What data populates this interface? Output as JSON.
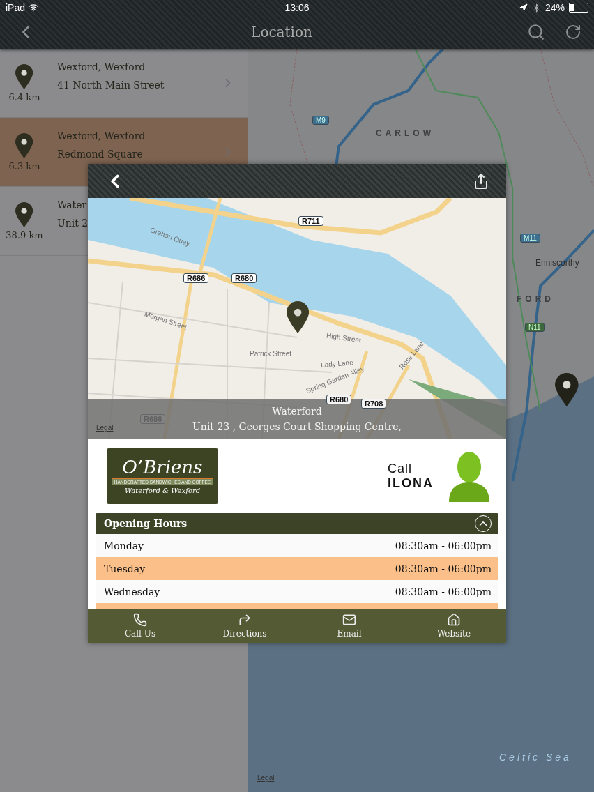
{
  "status_bar": {
    "carrier": "iPad",
    "time": "13:06",
    "battery": "24%"
  },
  "nav": {
    "title": "Location"
  },
  "locations": [
    {
      "distance": "6.4 km",
      "name": "Wexford, Wexford",
      "address": "41 North Main Street",
      "selected": false
    },
    {
      "distance": "6.3 km",
      "name": "Wexford, Wexford",
      "address": "Redmond Square",
      "selected": true
    },
    {
      "distance": "38.9 km",
      "name": "Water",
      "address": "Unit 2",
      "selected": false
    }
  ],
  "map": {
    "labels": [
      "CARLOW",
      "M9",
      "M11",
      "Enniscorthy",
      "FORD",
      "N11",
      "Celtic Sea"
    ],
    "legal": "Legal"
  },
  "detail": {
    "map_labels": [
      "R711",
      "R686",
      "R680",
      "Grattan Quay",
      "Morgan Street",
      "High Street",
      "Patrick Street",
      "Lady Lane",
      "Spring Garden Alley",
      "Rose Lane",
      "R680",
      "R708",
      "R686"
    ],
    "legal": "Legal",
    "city": "Waterford",
    "address": "Unit 23 , Georges Court Shopping Centre,",
    "logo": {
      "brand": "O’Briens",
      "tagline": "HANDCRAFTED SANDWICHES AND COFFEE",
      "region": "Waterford & Wexford"
    },
    "call": {
      "prefix": "Call",
      "name": "ILONA"
    },
    "hours": {
      "title": "Opening Hours",
      "expanded": true,
      "days": [
        {
          "day": "Monday",
          "time": "08:30am - 06:00pm"
        },
        {
          "day": "Tuesday",
          "time": "08:30am - 06:00pm"
        },
        {
          "day": "Wednesday",
          "time": "08:30am - 06:00pm"
        }
      ]
    },
    "actions": [
      {
        "label": "Call Us",
        "kind": "phone"
      },
      {
        "label": "Directions",
        "kind": "directions"
      },
      {
        "label": "Email",
        "kind": "email"
      },
      {
        "label": "Website",
        "kind": "website"
      }
    ]
  }
}
